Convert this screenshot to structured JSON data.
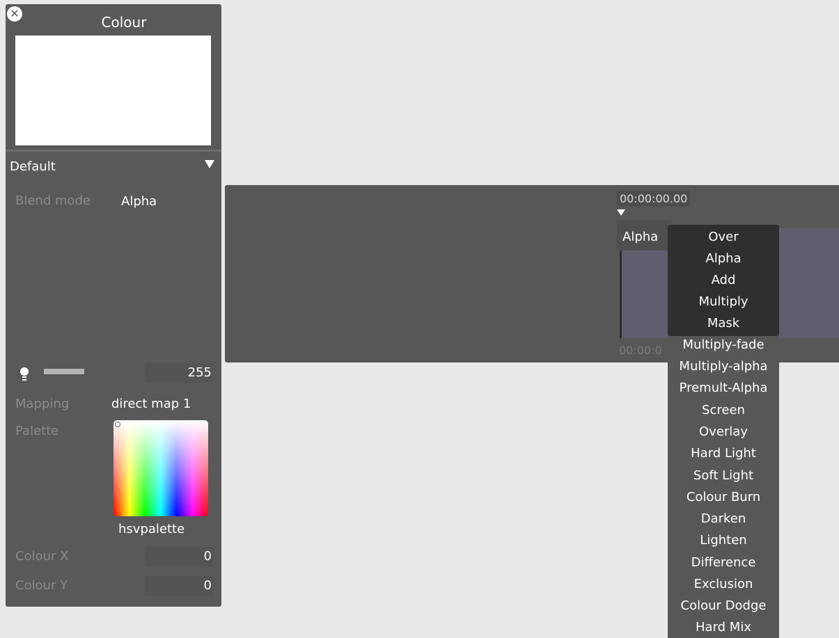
{
  "panel": {
    "title": "Colour",
    "preset": "Default",
    "blend_mode_label": "Blend mode",
    "blend_mode_value": "Alpha",
    "brightness_value": "255",
    "mapping_label": "Mapping",
    "mapping_value": "direct map 1",
    "palette_label": "Palette",
    "palette_name": "hsvpalette",
    "colour_x_label": "Colour X",
    "colour_x_value": "0",
    "colour_y_label": "Colour Y",
    "colour_y_value": "0"
  },
  "timeline": {
    "timecode_top": "00:00:00.00",
    "clip_label": "Alpha",
    "timecode_bottom": "00:00:0"
  },
  "blend_menu": {
    "options": [
      "Over",
      "Alpha",
      "Add",
      "Multiply",
      "Mask",
      "Multiply-fade",
      "Multiply-alpha",
      "Premult-Alpha",
      "Screen",
      "Overlay",
      "Hard Light",
      "Soft Light",
      "Colour Burn",
      "Darken",
      "Lighten",
      "Difference",
      "Exclusion",
      "Colour Dodge",
      "Hard Mix"
    ]
  },
  "colors": {
    "panel_bg": "#595959",
    "page_bg": "#e8e9e8",
    "clip_bg": "#5f5d6e"
  }
}
